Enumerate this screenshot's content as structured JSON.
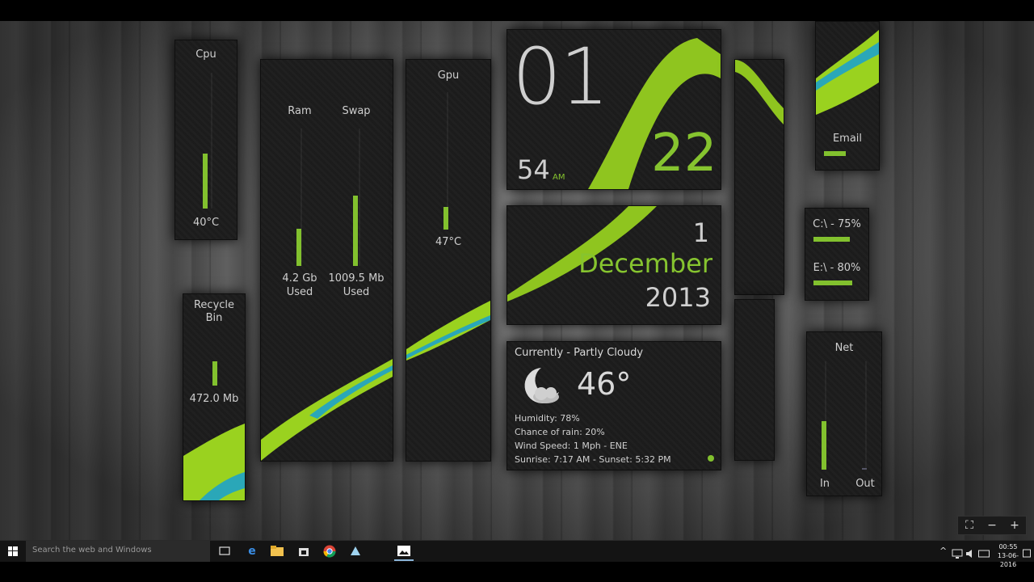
{
  "widgets": {
    "cpu": {
      "title": "Cpu",
      "temp": "40°C",
      "level": 0.35
    },
    "ram": {
      "title": "Ram",
      "value": "4.2 Gb",
      "sub": "Used",
      "level": 0.25
    },
    "swap": {
      "title": "Swap",
      "value": "1009.5 Mb",
      "sub": "Used",
      "level": 0.5
    },
    "gpu": {
      "title": "Gpu",
      "temp": "47°C",
      "level": 0.12
    },
    "recycle": {
      "title_line1": "Recycle",
      "title_line2": "Bin",
      "size": "472.0 Mb",
      "level": 0.3
    },
    "clock": {
      "hour": "01",
      "minute": "22",
      "seconds": "54",
      "ampm": "AM"
    },
    "date": {
      "day": "1",
      "month": "December",
      "year": "2013"
    },
    "weather": {
      "heading": "Currently - Partly Cloudy",
      "temperature": "46°",
      "humidity": "Humidity: 78%",
      "rain": "Chance of rain: 20%",
      "wind": "Wind Speed: 1 Mph - ENE",
      "sun": "Sunrise: 7:17 AM - Sunset: 5:32 PM"
    },
    "email": {
      "title": "Email",
      "level": 0.45
    },
    "drives": [
      {
        "label": "C:\\ - 75%",
        "level": 0.75
      },
      {
        "label": "E:\\ - 80%",
        "level": 0.8
      }
    ],
    "net": {
      "title": "Net",
      "in_label": "In",
      "out_label": "Out",
      "in_level": 0.45,
      "out_level": 0.02
    }
  },
  "zoom_controls": {
    "fit": "⛶",
    "minus": "−",
    "plus": "+"
  },
  "taskbar": {
    "search_placeholder": "Search the web and Windows",
    "clock_time": "00:55",
    "clock_date": "13-06-2016",
    "tray_up": "^"
  },
  "colors": {
    "accent": "#82c12e",
    "panel": "#1c1c1c",
    "taskbar": "#141414"
  }
}
